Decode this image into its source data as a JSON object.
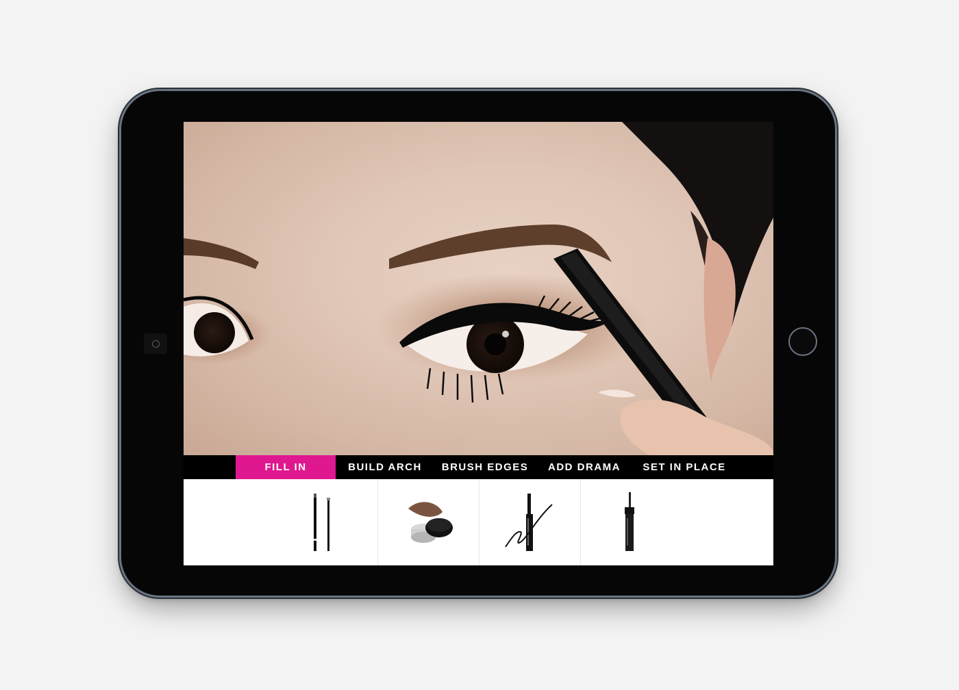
{
  "tabs": [
    {
      "label": "FILL IN",
      "active": true
    },
    {
      "label": "BUILD ARCH",
      "active": false
    },
    {
      "label": "BRUSH EDGES",
      "active": false
    },
    {
      "label": "ADD DRAMA",
      "active": false
    },
    {
      "label": "SET IN PLACE",
      "active": false
    }
  ],
  "products": [
    {
      "icon": "brow-pencil-icon"
    },
    {
      "icon": "brow-pomade-pot-icon"
    },
    {
      "icon": "liquid-eyeliner-icon"
    },
    {
      "icon": "mascara-icon"
    }
  ],
  "colors": {
    "accent": "#e0188f",
    "tab_bar": "#000000",
    "device_bezel": "#060606"
  }
}
